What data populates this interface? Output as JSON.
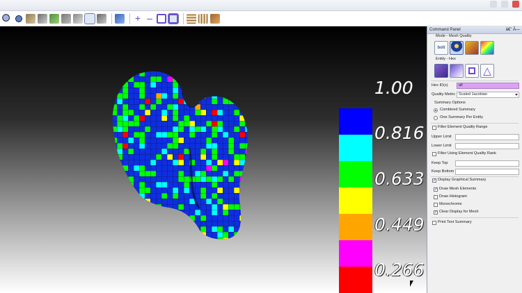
{
  "toolbar": {
    "icons": [
      "zoom-icon",
      "rotate-icon",
      "view-icon",
      "box-icon",
      "cube-icon",
      "cube-icon",
      "cube-icon",
      "select-icon",
      "select-icon",
      "cube-icon",
      "plus-icon",
      "minus-icon",
      "square-icon",
      "square-icon",
      "grid-icon",
      "grid-icon",
      "cube-icon"
    ]
  },
  "legend": {
    "values": [
      "1.00",
      "0.816",
      "0.633",
      "0.449",
      "0.266"
    ],
    "colors": [
      "#0000ff",
      "#00ffff",
      "#00ff00",
      "#ffff00",
      "#ffa500",
      "#ff00ff",
      "#ff0000"
    ]
  },
  "panel": {
    "title": "Command Panel",
    "header_buttons": "â€” Ã—",
    "mode_label": "Mode - Mesh Quality",
    "entity_label": "Entity - Hex",
    "hex_ids_label": "Hex ID(s)",
    "hex_ids_value": "all",
    "quality_metric_label": "Quality Metric",
    "quality_metric_value": "Scaled Jacobian",
    "summary_options_label": "Summary Options",
    "combined_summary": "Combined Summary",
    "one_summary_per_entity": "One Summary Per Entity",
    "filter_quality_range": "Filter Element Quality Range",
    "upper_limit": "Upper Limit",
    "lower_limit": "Lower Limit",
    "filter_quality_rank": "Filter Using Element Quality Rank",
    "keep_top": "Keep Top",
    "keep_bottom": "Keep Bottom",
    "display_graphical_summary": "Display Graphical Summary",
    "draw_mesh_elements": "Draw Mesh Elements",
    "draw_histogram": "Draw Histogram",
    "monochrome": "Monochrome",
    "clear_display_for_mesh": "Clear Display for Mesh",
    "print_text_summary": "Print Text Summary"
  },
  "checkbox_states": {
    "filter_quality_range": false,
    "filter_quality_rank": false,
    "display_graphical_summary": true,
    "draw_mesh_elements": true,
    "draw_histogram": false,
    "monochrome": false,
    "clear_display_for_mesh": true,
    "print_text_summary": false
  },
  "radio_selected": "combined_summary"
}
